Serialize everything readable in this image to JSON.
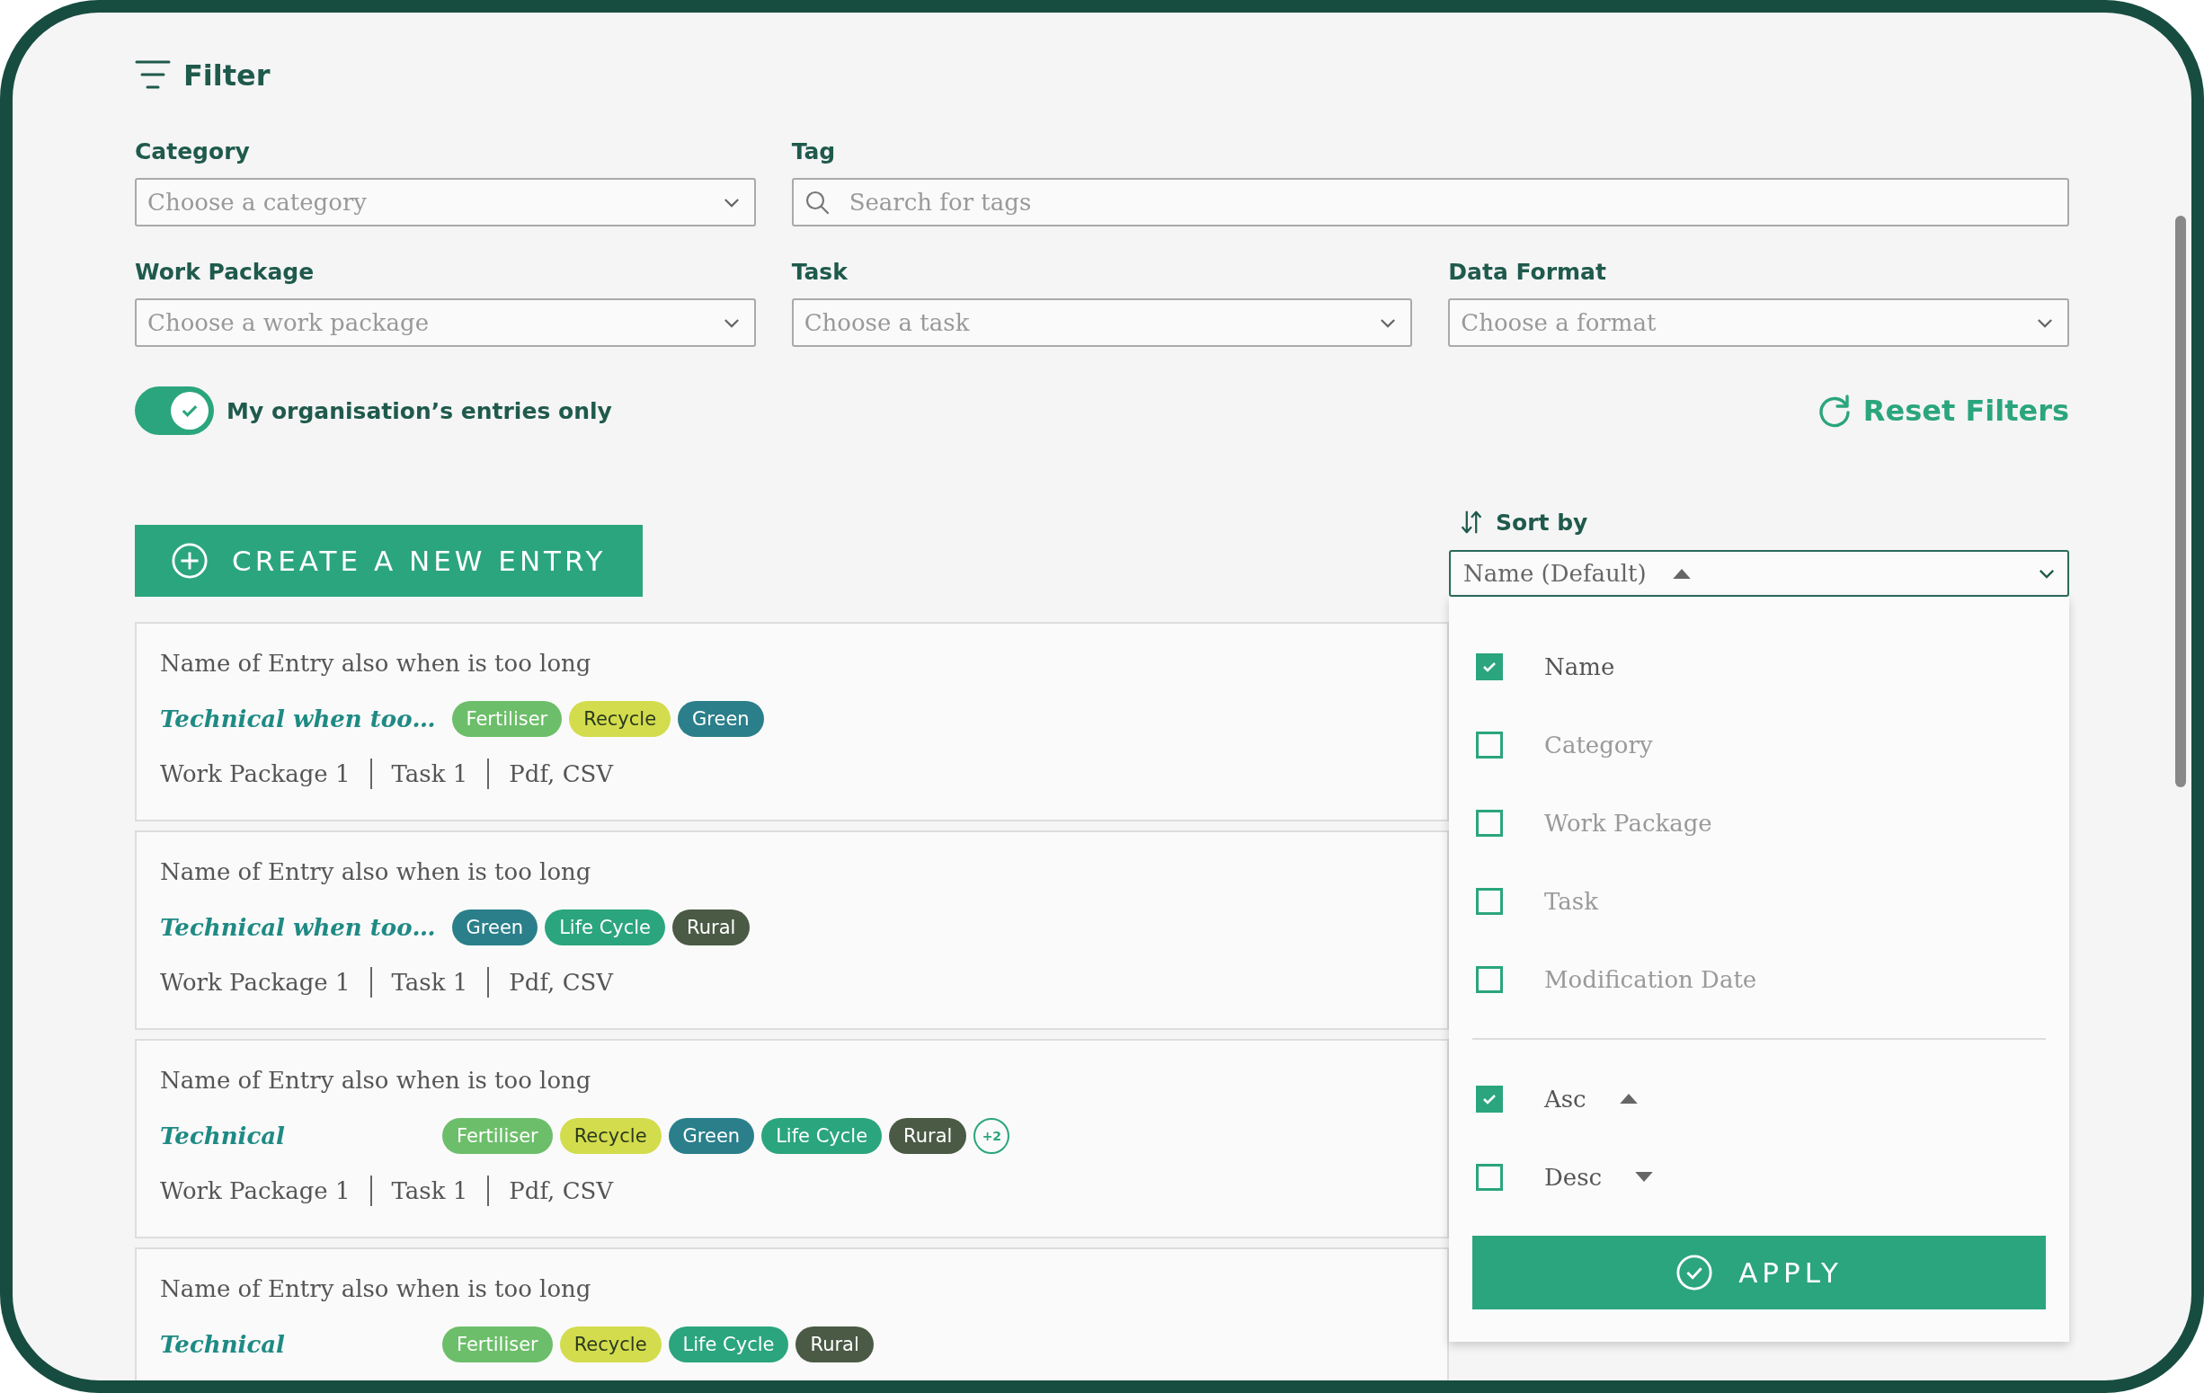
{
  "header": {
    "title": "Filter"
  },
  "filters": [
    {
      "label": "Category",
      "kind": "select",
      "placeholder": "Choose a category"
    },
    {
      "label": "Tag",
      "kind": "search",
      "placeholder": "Search for tags"
    },
    {
      "label": "Work Package",
      "kind": "select",
      "placeholder": "Choose a work package"
    },
    {
      "label": "Task",
      "kind": "select",
      "placeholder": "Choose a task"
    },
    {
      "label": "Data Format",
      "kind": "select",
      "placeholder": "Choose a format"
    }
  ],
  "toggle": {
    "label": "My organisation’s entries only",
    "on": true
  },
  "reset_button": "Reset Filters",
  "create_button": "CREATE A NEW ENTRY",
  "entries": [
    {
      "name": "Name of Entry also when is too long",
      "category": "Technical when too…",
      "tags": [
        {
          "label": "Fertiliser",
          "color": "#6dbe6a"
        },
        {
          "label": "Recycle",
          "color": "#d3dc4c"
        },
        {
          "label": "Green",
          "color": "#2a7f8a"
        }
      ],
      "meta": [
        "Work Package 1",
        "Task 1",
        "Pdf, CSV"
      ]
    },
    {
      "name": "Name of Entry also when is too long",
      "category": "Technical when too…",
      "tags": [
        {
          "label": "Green",
          "color": "#2a7f8a"
        },
        {
          "label": "Life Cycle",
          "color": "#2ba57d"
        },
        {
          "label": "Rural",
          "color": "#4a5a45"
        }
      ],
      "meta": [
        "Work Package 1",
        "Task 1",
        "Pdf, CSV"
      ]
    },
    {
      "name": "Name of Entry also when is too long",
      "category": "Technical",
      "tags": [
        {
          "label": "Fertiliser",
          "color": "#6dbe6a"
        },
        {
          "label": "Recycle",
          "color": "#d3dc4c"
        },
        {
          "label": "Green",
          "color": "#2a7f8a"
        },
        {
          "label": "Life Cycle",
          "color": "#2ba57d"
        },
        {
          "label": "Rural",
          "color": "#4a5a45"
        }
      ],
      "more": "+2",
      "meta": [
        "Work Package 1",
        "Task 1",
        "Pdf, CSV"
      ]
    },
    {
      "name": "Name of Entry also when is too long",
      "category": "Technical",
      "tags": [
        {
          "label": "Fertiliser",
          "color": "#6dbe6a"
        },
        {
          "label": "Recycle",
          "color": "#d3dc4c"
        },
        {
          "label": "Life Cycle",
          "color": "#2ba57d"
        },
        {
          "label": "Rural",
          "color": "#4a5a45"
        }
      ]
    }
  ],
  "sort": {
    "label": "Sort by",
    "value": "Name (Default)",
    "options": [
      {
        "label": "Name",
        "selected": true
      },
      {
        "label": "Category",
        "selected": false
      },
      {
        "label": "Work Package",
        "selected": false
      },
      {
        "label": "Task",
        "selected": false
      },
      {
        "label": "Modification Date",
        "selected": false
      }
    ],
    "order": [
      {
        "label": "Asc",
        "kind": "asc",
        "selected": true
      },
      {
        "label": "Desc",
        "kind": "desc",
        "selected": false
      }
    ],
    "apply_button": "APPLY"
  }
}
